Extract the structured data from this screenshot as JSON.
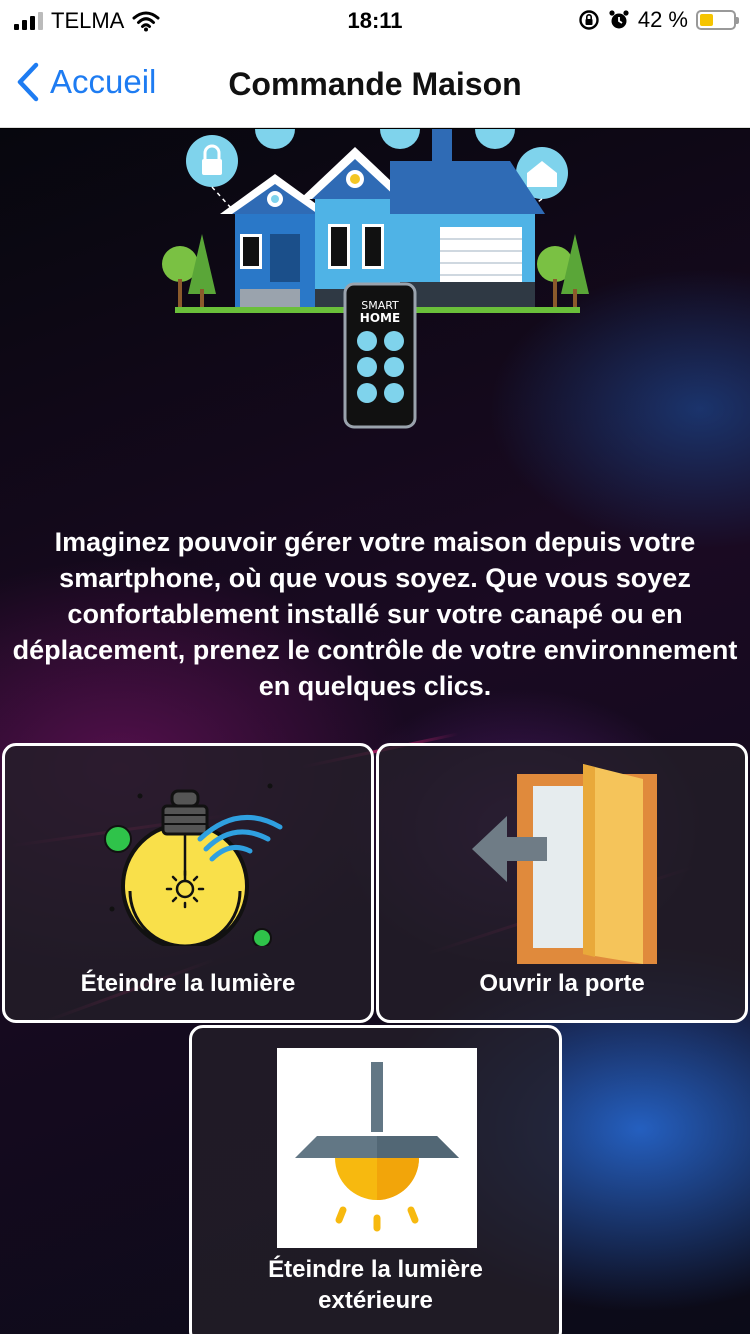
{
  "status_bar": {
    "carrier": "TELMA",
    "time": "18:11",
    "battery_text": "42 %",
    "battery_level": 0.42,
    "icons": [
      "signal-icon",
      "wifi-icon",
      "orientation-lock-icon",
      "alarm-icon",
      "battery-icon"
    ]
  },
  "nav": {
    "back_label": "Accueil",
    "title": "Commande Maison"
  },
  "hero": {
    "phone_line1": "SMART",
    "phone_line2": "HOME"
  },
  "intro_text": "Imaginez pouvoir gérer votre maison depuis votre smartphone, où que vous soyez. Que vous soyez confortablement installé sur votre canapé ou en déplacement, prenez le contrôle de votre environnement en quelques clics.",
  "actions": {
    "light_off": {
      "label": "Éteindre la lumière",
      "icon": "smart-bulb-icon"
    },
    "open_door": {
      "label": "Ouvrir la porte",
      "icon": "door-icon"
    },
    "outdoor_light_off": {
      "label_line1": "Éteindre la lumière",
      "label_line2": "extérieure",
      "icon": "ceiling-lamp-icon"
    }
  },
  "colors": {
    "accent": "#1e7cf2",
    "tile_border": "#ffffff",
    "bulb_yellow": "#f9e04a",
    "door_orange": "#e08a3c",
    "lamp_yellow": "#f7b90f"
  }
}
